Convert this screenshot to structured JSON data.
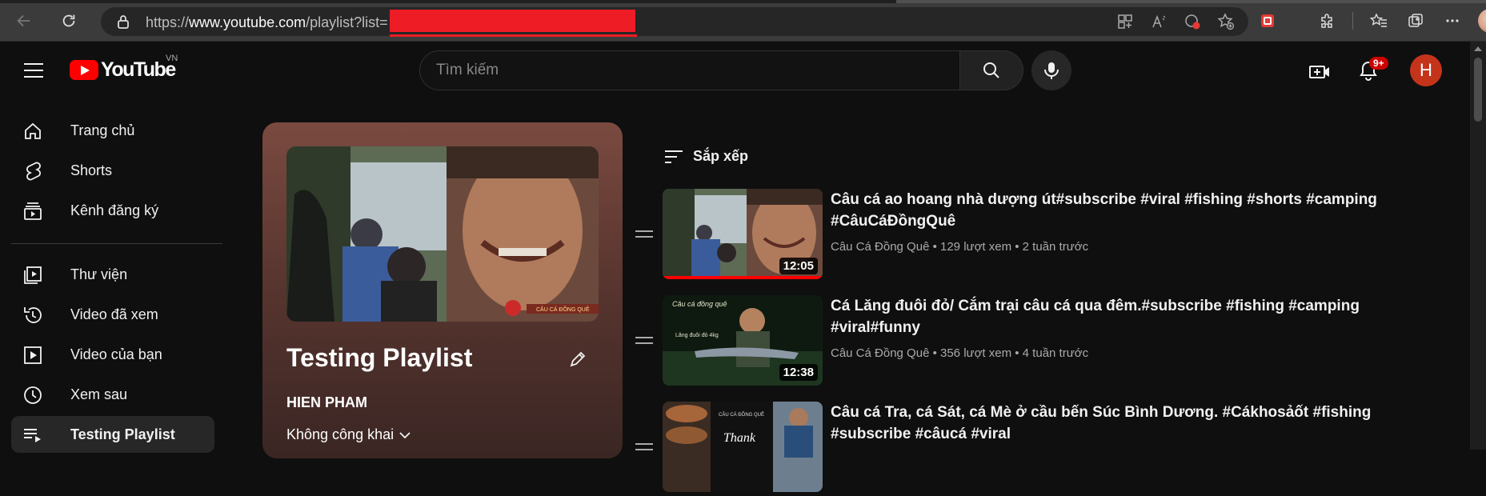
{
  "browser": {
    "url_prefix": "https://",
    "url_host": "www.youtube.com",
    "url_path": "/playlist?list="
  },
  "header": {
    "logo_text": "YouTube",
    "region": "VN",
    "search_placeholder": "Tìm kiếm",
    "notification_count": "9+",
    "account_initial": "H"
  },
  "sidebar": {
    "items": [
      {
        "label": "Trang chủ",
        "icon": "home-icon"
      },
      {
        "label": "Shorts",
        "icon": "shorts-icon"
      },
      {
        "label": "Kênh đăng ký",
        "icon": "subscriptions-icon"
      },
      {
        "label": "Thư viện",
        "icon": "library-icon"
      },
      {
        "label": "Video đã xem",
        "icon": "history-icon"
      },
      {
        "label": "Video của bạn",
        "icon": "your-videos-icon"
      },
      {
        "label": "Xem sau",
        "icon": "watch-later-icon"
      },
      {
        "label": "Testing Playlist",
        "icon": "playlist-icon",
        "active": true
      }
    ]
  },
  "playlist": {
    "title": "Testing Playlist",
    "owner": "HIEN PHAM",
    "privacy": "Không công khai"
  },
  "sort": {
    "label": "Sắp xếp"
  },
  "videos": [
    {
      "title": "Câu cá ao hoang nhà dượng út#subscribe #viral #fishing #shorts #camping #CâuCáĐồngQuê",
      "channel": "Câu Cá Đồng Quê",
      "views": "129 lượt xem",
      "age": "2 tuần trước",
      "duration": "12:05"
    },
    {
      "title": "Cá Lăng đuôi đỏ/ Cắm trại câu cá qua đêm.#subscribe #fishing #camping #viral#funny",
      "channel": "Câu Cá Đồng Quê",
      "views": "356 lượt xem",
      "age": "4 tuần trước",
      "duration": "12:38"
    },
    {
      "title": "Câu cá Tra, cá Sát, cá Mè ở cầu bến Súc Bình Dương. #Cákhosảốt #fishing #subscribe #câucá #viral",
      "channel": "",
      "views": "",
      "age": "",
      "duration": ""
    }
  ],
  "thumb_captions": {
    "t2_top": "Câu cá đồng quê",
    "t2_mid": "Lăng đuôi đỏ 4kg",
    "t3_a": "CÂU CÁ ĐỒNG QUÊ",
    "t3_b": "Thank"
  }
}
